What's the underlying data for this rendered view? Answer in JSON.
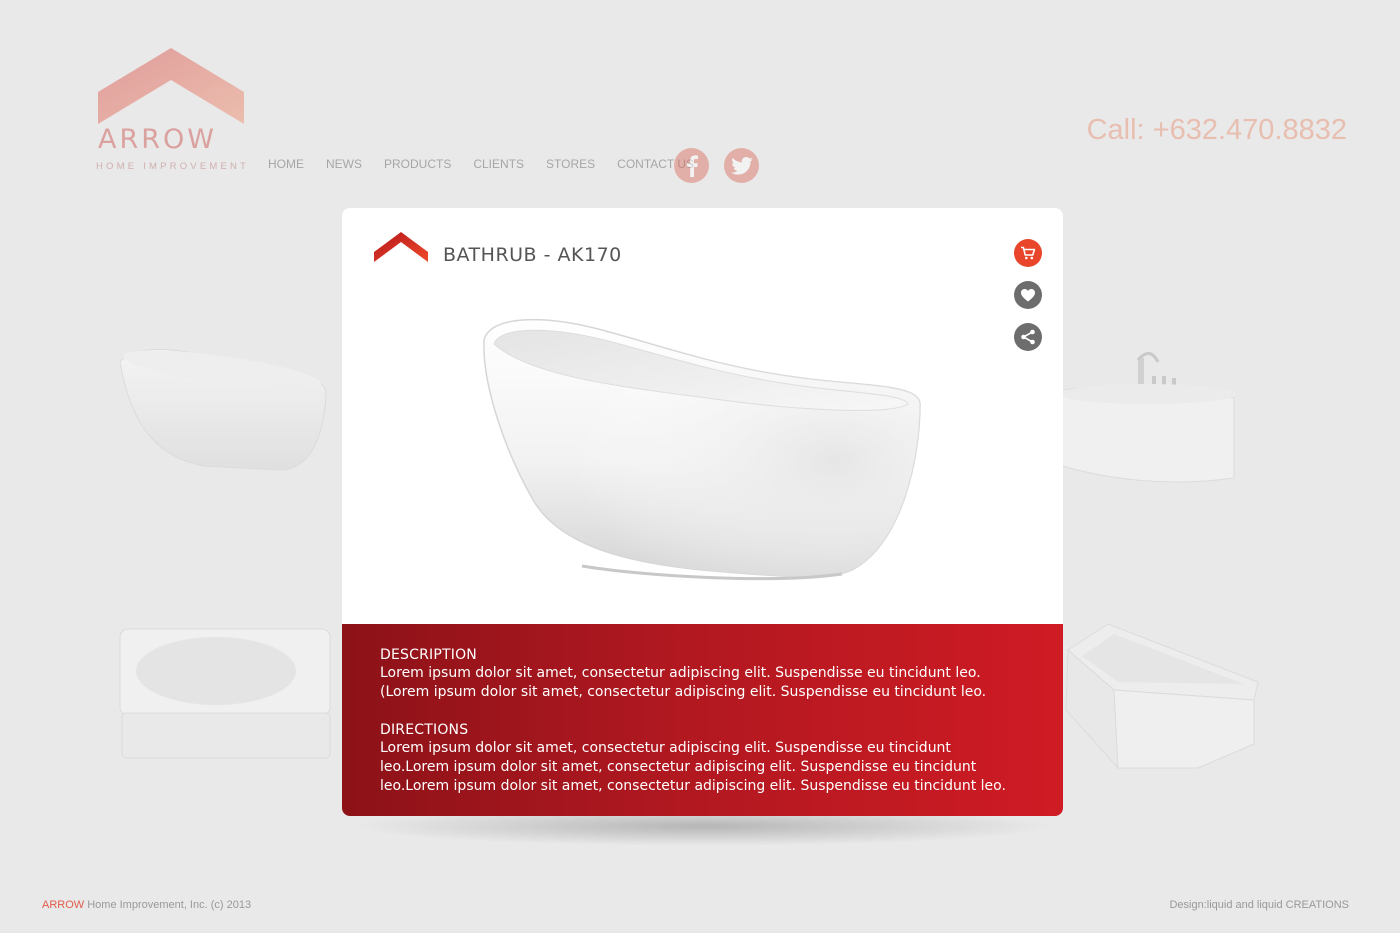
{
  "brand": {
    "name": "ARROW",
    "tagline": "HOME IMPROVEMENT",
    "colors": {
      "primary": "#cf1b24",
      "accent": "#e8452a",
      "roof_top": "#d6403c",
      "roof_bottom": "#f08a68"
    }
  },
  "nav": {
    "items": [
      {
        "label": "HOME"
      },
      {
        "label": "NEWS"
      },
      {
        "label": "PRODUCTS"
      },
      {
        "label": "CLIENTS"
      },
      {
        "label": "STORES"
      },
      {
        "label": "CONTACT US"
      }
    ],
    "social": [
      "facebook-icon",
      "twitter-icon"
    ]
  },
  "phone": "Call: +632.470.8832",
  "modal": {
    "title": "BATHRUB - AK170",
    "actions": [
      "cart-icon",
      "heart-icon",
      "share-icon"
    ],
    "description_heading": "DESCRIPTION",
    "description_line1": "Lorem ipsum dolor sit amet, consectetur adipiscing elit. Suspendisse eu tincidunt leo.",
    "description_line2": "(Lorem ipsum dolor sit amet, consectetur adipiscing elit. Suspendisse eu tincidunt leo.",
    "directions_heading": "DIRECTIONS",
    "directions_line1": "Lorem ipsum dolor sit amet, consectetur adipiscing elit. Suspendisse eu tincidunt",
    "directions_line2": "leo.Lorem ipsum dolor sit amet, consectetur adipiscing elit. Suspendisse eu tincidunt",
    "directions_line3": "leo.Lorem ipsum dolor sit amet, consectetur adipiscing elit. Suspendisse eu tincidunt leo."
  },
  "footer": {
    "brand": "ARROW",
    "copyright": " Home Improvement, Inc. (c) 2013",
    "credit": "Design:liquid and liquid CREATIONS"
  }
}
